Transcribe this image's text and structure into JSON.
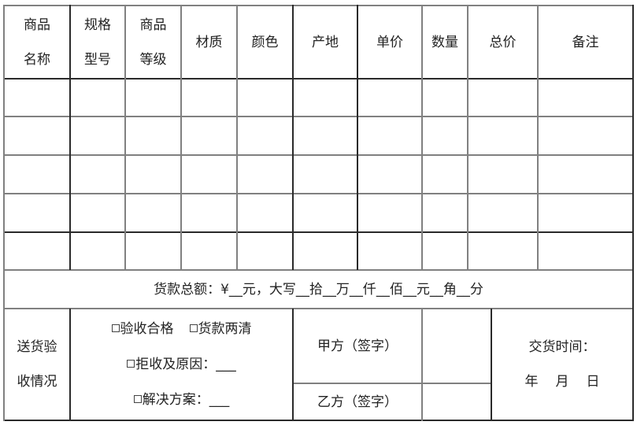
{
  "form": {
    "headers": [
      {
        "line1": "商品",
        "line2": "名称"
      },
      {
        "line1": "规格",
        "line2": "型号"
      },
      {
        "line1": "商品",
        "line2": "等级"
      },
      {
        "line1": "材质",
        "line2": ""
      },
      {
        "line1": "颜色",
        "line2": ""
      },
      {
        "line1": "产地",
        "line2": ""
      },
      {
        "line1": "单价",
        "line2": ""
      },
      {
        "line1": "数量",
        "line2": ""
      },
      {
        "line1": "总价",
        "line2": ""
      },
      {
        "line1": "备注",
        "line2": ""
      }
    ],
    "empty_rows": 5,
    "total_amount_text": "货款总额：¥__元，大写__拾__万__仟__佰__元__角__分",
    "delivery_label": {
      "line1": "送货验",
      "line2": "收情况"
    },
    "options": {
      "accepted": "验收合格",
      "paid": "货款两清",
      "rejected": "拒收及原因：___",
      "solution": "解决方案：___"
    },
    "party_a": "甲方（签字）",
    "party_b": "乙方（签字）",
    "delivery_time": {
      "label": "交货时间：",
      "year": "年",
      "month": "月",
      "day": "日"
    }
  }
}
